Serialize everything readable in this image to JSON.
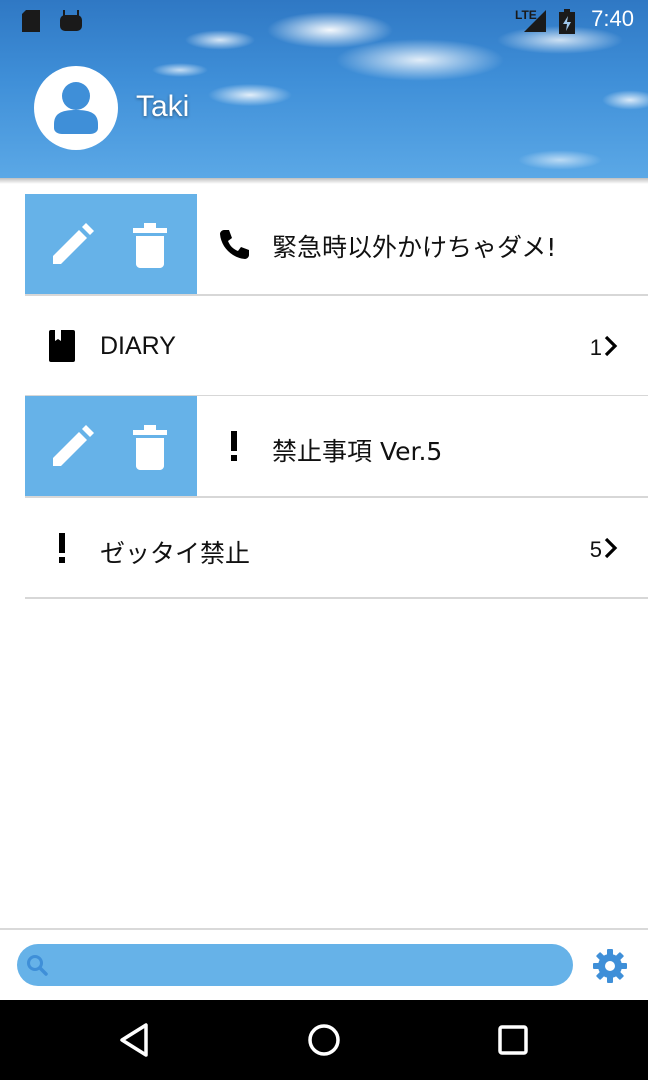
{
  "status_bar": {
    "time": "7:40",
    "network_label": "LTE",
    "icons": [
      "sd-card-icon",
      "android-icon",
      "signal-icon",
      "battery-charging-icon"
    ]
  },
  "profile": {
    "name": "Taki",
    "avatar_icon": "person-icon"
  },
  "list": {
    "items": [
      {
        "label": "緊急時以外かけちゃダメ!",
        "icon": "phone-icon",
        "count": "",
        "swiped": true
      },
      {
        "label": "DIARY",
        "icon": "book-icon",
        "count": "1",
        "swiped": false
      },
      {
        "label": "禁止事項 Ver.5",
        "icon": "exclamation-icon",
        "count": "",
        "swiped": true
      },
      {
        "label": "ゼッタイ禁止",
        "icon": "exclamation-icon",
        "count": "5",
        "swiped": false
      }
    ]
  },
  "search": {
    "value": "",
    "placeholder": ""
  },
  "colors": {
    "accent": "#66b2e8",
    "gear": "#3f8fd8",
    "divider": "#d7d7d7"
  },
  "nav": {
    "buttons": [
      "back-icon",
      "home-icon",
      "recents-icon"
    ]
  }
}
